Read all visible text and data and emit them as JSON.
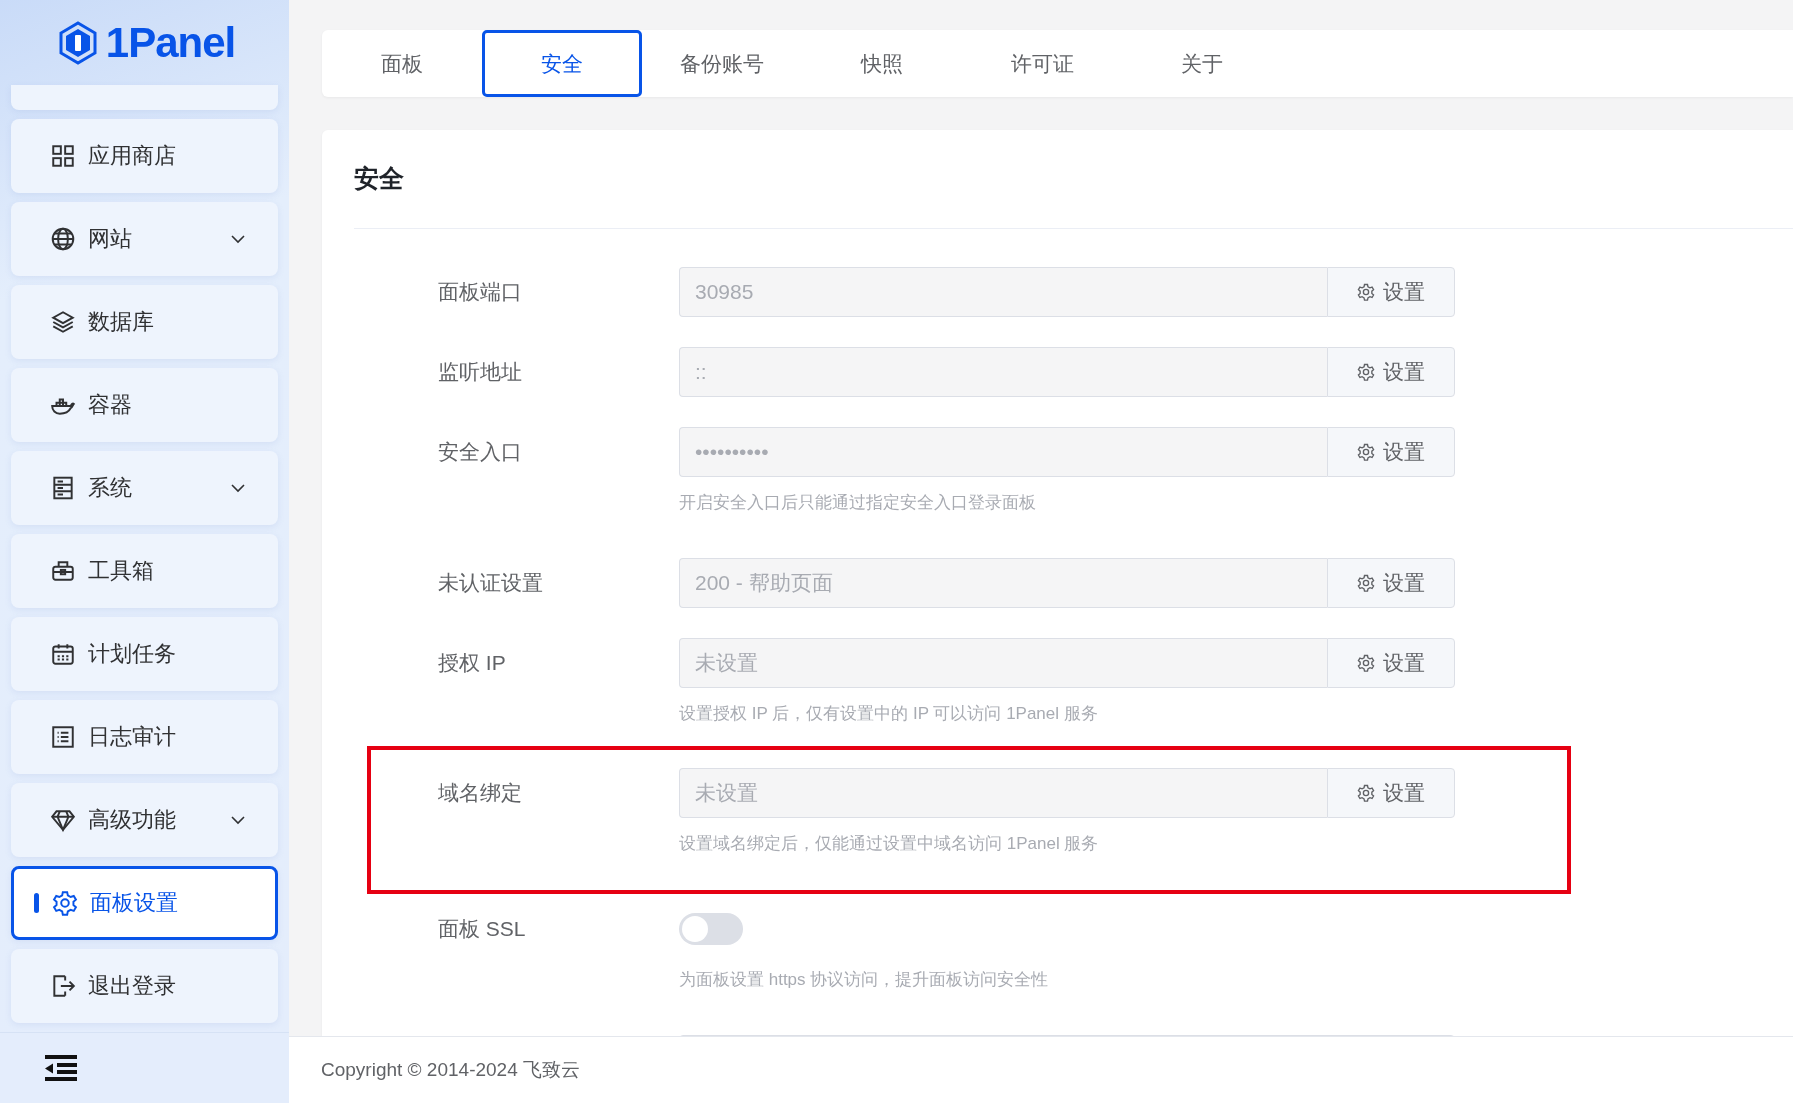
{
  "logo": {
    "text": "1Panel"
  },
  "sidebar": {
    "items": [
      {
        "label": "应用商店",
        "expandable": false,
        "selected": false
      },
      {
        "label": "网站",
        "expandable": true,
        "selected": false
      },
      {
        "label": "数据库",
        "expandable": false,
        "selected": false
      },
      {
        "label": "容器",
        "expandable": false,
        "selected": false
      },
      {
        "label": "系统",
        "expandable": true,
        "selected": false
      },
      {
        "label": "工具箱",
        "expandable": false,
        "selected": false
      },
      {
        "label": "计划任务",
        "expandable": false,
        "selected": false
      },
      {
        "label": "日志审计",
        "expandable": false,
        "selected": false
      },
      {
        "label": "高级功能",
        "expandable": true,
        "selected": false
      },
      {
        "label": "面板设置",
        "expandable": false,
        "selected": true
      },
      {
        "label": "退出登录",
        "expandable": false,
        "selected": false
      }
    ]
  },
  "tabs": [
    {
      "label": "面板",
      "selected": false
    },
    {
      "label": "安全",
      "selected": true
    },
    {
      "label": "备份账号",
      "selected": false
    },
    {
      "label": "快照",
      "selected": false
    },
    {
      "label": "许可证",
      "selected": false
    },
    {
      "label": "关于",
      "selected": false
    }
  ],
  "section": {
    "title": "安全",
    "fields": [
      {
        "kind": "input",
        "label": "面板端口",
        "value": "30985",
        "button": "设置",
        "highlighted": false
      },
      {
        "kind": "input",
        "label": "监听地址",
        "value": "::",
        "button": "设置",
        "highlighted": false
      },
      {
        "kind": "input",
        "label": "安全入口",
        "value": "••••••••••",
        "button": "设置",
        "hint": "开启安全入口后只能通过指定安全入口登录面板",
        "highlighted": false
      },
      {
        "kind": "input",
        "label": "未认证设置",
        "value": "200 - 帮助页面",
        "button": "设置",
        "highlighted": false
      },
      {
        "kind": "input",
        "label": "授权 IP",
        "placeholder": "未设置",
        "button": "设置",
        "hint": "设置授权 IP 后，仅有设置中的 IP 可以访问 1Panel 服务",
        "highlighted": false
      },
      {
        "kind": "input",
        "label": "域名绑定",
        "placeholder": "未设置",
        "button": "设置",
        "hint": "设置域名绑定后，仅能通过设置中域名访问 1Panel 服务",
        "highlighted": true
      },
      {
        "kind": "switch",
        "label": "面板 SSL",
        "on": false,
        "hint": "为面板设置 https 协议访问，提升面板访问安全性",
        "highlighted": false
      }
    ]
  },
  "footer": {
    "copyright": "Copyright © 2014-2024 飞致云"
  }
}
